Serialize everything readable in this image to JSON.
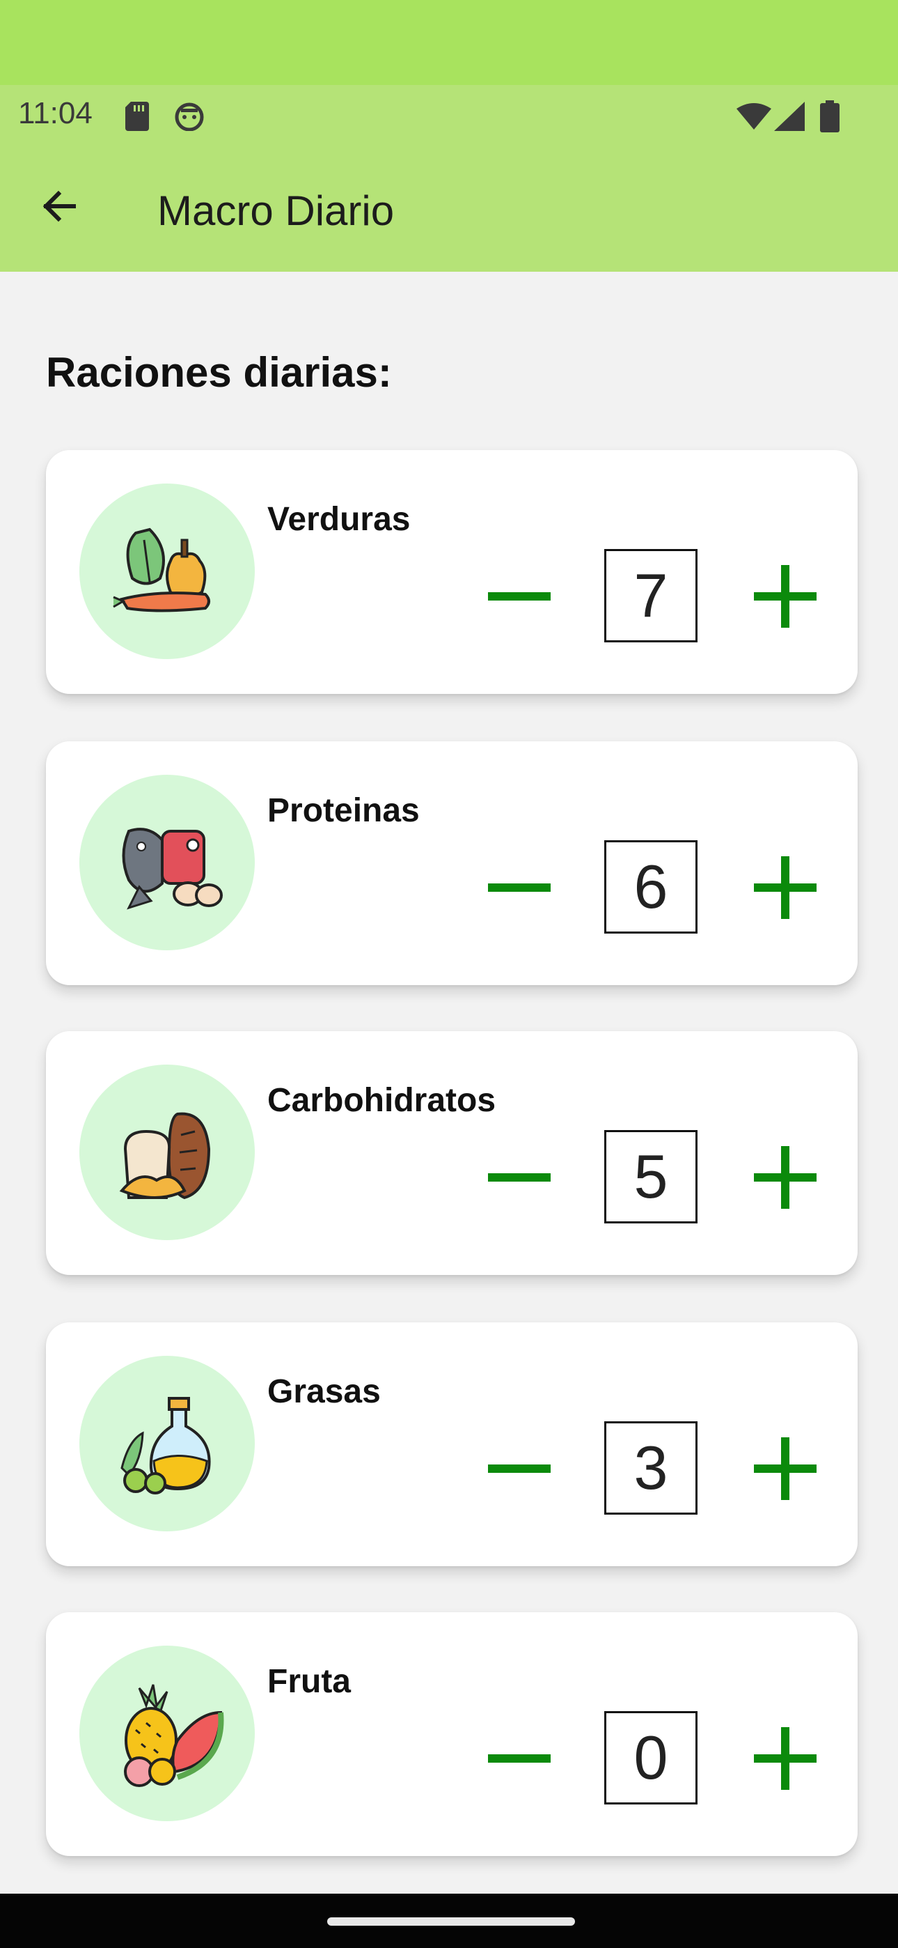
{
  "status_bar": {
    "time": "11:04",
    "icons": [
      "sd-card-icon",
      "robot-icon",
      "wifi-icon",
      "signal-icon",
      "battery-icon"
    ]
  },
  "app_bar": {
    "back_icon": "arrow-left-icon",
    "title": "Macro Diario"
  },
  "section_title": "Raciones diarias:",
  "items": [
    {
      "label": "Verduras",
      "value": "7",
      "icon": "vegetables-icon"
    },
    {
      "label": "Proteinas",
      "value": "6",
      "icon": "proteins-icon"
    },
    {
      "label": "Carbohidratos",
      "value": "5",
      "icon": "carbohydrates-icon"
    },
    {
      "label": "Grasas",
      "value": "3",
      "icon": "fats-icon"
    },
    {
      "label": "Fruta",
      "value": "0",
      "icon": "fruit-icon"
    }
  ],
  "colors": {
    "app_bar": "#b5e377",
    "top_band": "#a8e35e",
    "accent_green": "#0b8a0b",
    "icon_circle": "#d6f8d8",
    "background": "#f2f2f2"
  }
}
